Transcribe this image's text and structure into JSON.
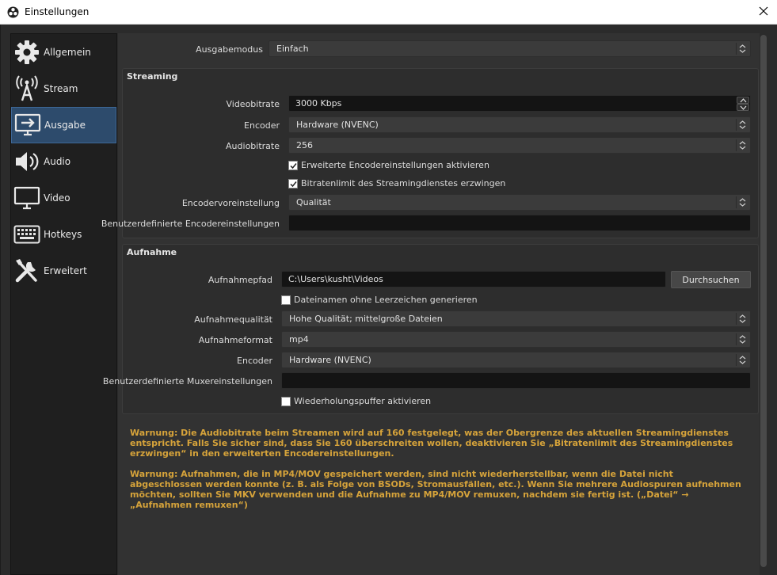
{
  "window": {
    "title": "Einstellungen",
    "app_icon": "obs-icon",
    "close": "close-icon"
  },
  "sidebar": {
    "items": [
      {
        "label": "Allgemein",
        "icon": "gear-icon",
        "active": false
      },
      {
        "label": "Stream",
        "icon": "broadcast-icon",
        "active": false
      },
      {
        "label": "Ausgabe",
        "icon": "output-icon",
        "active": true
      },
      {
        "label": "Audio",
        "icon": "speaker-icon",
        "active": false
      },
      {
        "label": "Video",
        "icon": "monitor-icon",
        "active": false
      },
      {
        "label": "Hotkeys",
        "icon": "keyboard-icon",
        "active": false
      },
      {
        "label": "Erweitert",
        "icon": "tools-icon",
        "active": false
      }
    ]
  },
  "output_mode": {
    "label": "Ausgabemodus",
    "value": "Einfach"
  },
  "streaming": {
    "title": "Streaming",
    "video_bitrate": {
      "label": "Videobitrate",
      "value": "3000 Kbps"
    },
    "encoder": {
      "label": "Encoder",
      "value": "Hardware (NVENC)"
    },
    "audio_bitrate": {
      "label": "Audiobitrate",
      "value": "256"
    },
    "advanced_encoder": {
      "label": "Erweiterte Encodereinstellungen aktivieren",
      "checked": true
    },
    "enforce_limits": {
      "label": "Bitratenlimit des Streamingdienstes erzwingen",
      "checked": true
    },
    "preset": {
      "label": "Encodervoreinstellung",
      "value": "Qualität"
    },
    "custom_settings": {
      "label": "Benutzerdefinierte Encodereinstellungen",
      "value": ""
    }
  },
  "recording": {
    "title": "Aufnahme",
    "path": {
      "label": "Aufnahmepfad",
      "value": "C:\\Users\\kusht\\Videos",
      "browse": "Durchsuchen"
    },
    "no_spaces": {
      "label": "Dateinamen ohne Leerzeichen generieren",
      "checked": false
    },
    "quality": {
      "label": "Aufnahmequalität",
      "value": "Hohe Qualität; mittelgroße Dateien"
    },
    "format": {
      "label": "Aufnahmeformat",
      "value": "mp4"
    },
    "encoder": {
      "label": "Encoder",
      "value": "Hardware (NVENC)"
    },
    "muxer": {
      "label": "Benutzerdefinierte Muxereinstellungen",
      "value": ""
    },
    "replay_buffer": {
      "label": "Wiederholungspuffer aktivieren",
      "checked": false
    }
  },
  "warnings": {
    "audio": "Warnung: Die Audiobitrate beim Streamen wird auf 160 festgelegt, was der Obergrenze des aktuellen Streamingdienstes entspricht. Falls Sie sicher sind, dass Sie 160 überschreiten wollen, deaktivieren Sie „Bitratenlimit des Streamingdienstes erzwingen“ in den erweiterten Encodereinstellungen.",
    "mp4": "Warnung: Aufnahmen, die in MP4/MOV gespeichert werden, sind nicht wiederherstellbar, wenn die Datei nicht abgeschlossen werden konnte (z. B. als Folge von BSODs, Stromausfällen, etc.). Wenn Sie mehrere Audiospuren aufnehmen möchten, sollten Sie MKV verwenden und die Aufnahme zu MP4/MOV remuxen, nachdem sie fertig ist. („Datei“ → „Aufnahmen remuxen“)"
  },
  "colors": {
    "accent": "#2d4b6c",
    "warning": "#d6a33a"
  }
}
